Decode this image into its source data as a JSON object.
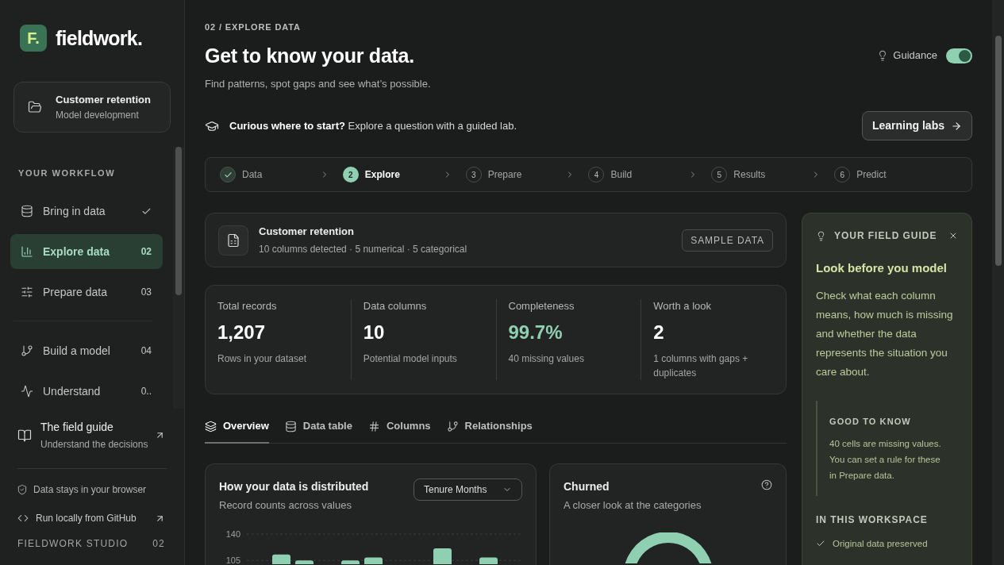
{
  "sidebar": {
    "logo": {
      "mark": "F.",
      "name": "fieldwork."
    },
    "project": {
      "title": "Customer retention",
      "subtitle": "Model development"
    },
    "workflow": {
      "heading": "YOUR WORKFLOW",
      "groups": [
        [
          {
            "label": "Bring in data",
            "done": true,
            "selected": false
          },
          {
            "label": "Explore data",
            "number": "02",
            "done": false,
            "selected": true
          },
          {
            "label": "Prepare data",
            "number": "03",
            "done": false,
            "selected": false
          }
        ],
        [
          {
            "label": "Build a model",
            "number": "04",
            "done": false,
            "selected": false
          },
          {
            "label": "Understand",
            "number": "0..",
            "done": false,
            "selected": false
          }
        ]
      ]
    },
    "guide_link": {
      "title": "The field guide",
      "subtitle": "Understand the decisions"
    },
    "footer_links": [
      {
        "label": "Data stays in your browser",
        "external": false
      },
      {
        "label": "Run locally from GitHub",
        "external": true
      }
    ],
    "studio": {
      "label": "FIELDWORK STUDIO",
      "version": "02"
    }
  },
  "header": {
    "breadcrumb": "02 / EXPLORE DATA",
    "title": "Get to know your data.",
    "subtitle": "Find patterns, spot gaps and see what’s possible.",
    "guidance": {
      "label": "Guidance",
      "on": true
    }
  },
  "prompt": {
    "text": "**Curious where to start?** Explore a question with a guided lab.",
    "button": "Learning labs"
  },
  "stepper": [
    {
      "label": "Data",
      "done": true,
      "selected": false
    },
    {
      "number": "2",
      "label": "Explore",
      "done": false,
      "selected": true
    },
    {
      "number": "3",
      "label": "Prepare",
      "done": false,
      "selected": false
    },
    {
      "number": "4",
      "label": "Build",
      "done": false,
      "selected": false
    },
    {
      "number": "5",
      "label": "Results",
      "done": false,
      "selected": false
    },
    {
      "number": "6",
      "label": "Predict",
      "done": false,
      "selected": false
    }
  ],
  "dataset": {
    "title": "Customer retention",
    "meta": "10 columns detected · 5 numerical · 5 categorical",
    "badge": "SAMPLE DATA"
  },
  "stats": [
    {
      "label": "Total records",
      "value": "1,207",
      "note": "Rows in your dataset",
      "highlight": false
    },
    {
      "label": "Data columns",
      "value": "10",
      "note": "Potential model inputs",
      "highlight": false
    },
    {
      "label": "Completeness",
      "value": "99.7%",
      "note": "40 missing values",
      "highlight": true
    },
    {
      "label": "Worth a look",
      "value": "2",
      "note": "1 columns with gaps + duplicates",
      "highlight": false
    }
  ],
  "tabs": [
    {
      "label": "Overview",
      "selected": true
    },
    {
      "label": "Data table",
      "selected": false
    },
    {
      "label": "Columns",
      "selected": false
    },
    {
      "label": "Relationships",
      "selected": false
    }
  ],
  "distribution": {
    "title": "How your data is distributed",
    "subtitle": "Record counts across values",
    "select": {
      "value": "Tenure Months"
    },
    "chart_data": {
      "type": "bar",
      "ylim": [
        100,
        140
      ],
      "yticks": [
        105,
        140
      ],
      "values": [
        null,
        113,
        105,
        null,
        105,
        109,
        null,
        null,
        121,
        null,
        109,
        null
      ]
    }
  },
  "churned": {
    "title": "Churned",
    "subtitle": "A closer look at the categories"
  },
  "field_guide": {
    "heading": "YOUR FIELD GUIDE",
    "title": "Look before you model",
    "body": "Check what each column means, how much is missing and whether the data represents the situation you care about.",
    "note": {
      "heading": "GOOD TO KNOW",
      "text": "40 cells are missing values. You can set a rule for these in Prepare data."
    },
    "workspace": {
      "heading": "IN THIS WORKSPACE",
      "items": [
        "Original data preserved"
      ]
    }
  }
}
